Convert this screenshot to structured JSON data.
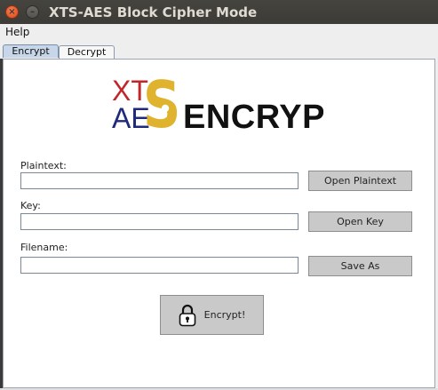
{
  "window": {
    "title": "XTS-AES Block Cipher Mode",
    "close_glyph": "×",
    "minimize_glyph": "–"
  },
  "menu": {
    "items": [
      "Help"
    ]
  },
  "tabs": [
    {
      "label": "Encrypt",
      "selected": true
    },
    {
      "label": "Decrypt",
      "selected": false
    }
  ],
  "logo": {
    "line1": "XT",
    "line2": "AE",
    "big_letter": "S",
    "word": "ENCRYPT",
    "colors": {
      "xt": "#c0262a",
      "ae": "#1f2a7a",
      "s": "#e0b32e",
      "word": "#111111"
    }
  },
  "form": {
    "plaintext_label": "Plaintext:",
    "plaintext_value": "",
    "open_plaintext_button": "Open Plaintext",
    "key_label": "Key:",
    "key_value": "",
    "open_key_button": "Open Key",
    "filename_label": "Filename:",
    "filename_value": "",
    "save_as_button": "Save As"
  },
  "encrypt_button": {
    "label": "Encrypt!",
    "icon": "lock-icon"
  }
}
